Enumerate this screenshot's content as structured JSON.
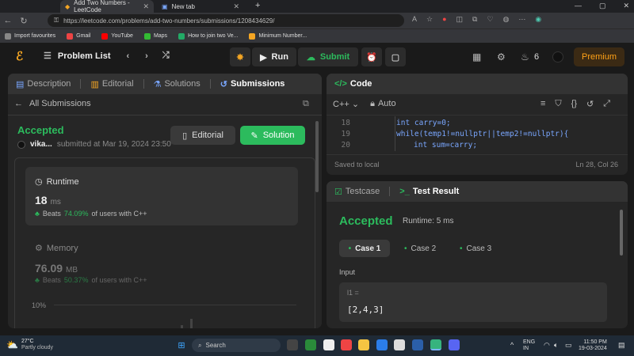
{
  "browser": {
    "tabs": [
      {
        "title": "Add Two Numbers - LeetCode",
        "active": true
      },
      {
        "title": "New tab",
        "active": false
      }
    ],
    "url": "https://leetcode.com/problems/add-two-numbers/submissions/1208434629/",
    "bookmarks": [
      "Import favourites",
      "Gmail",
      "YouTube",
      "Maps",
      "How to join two Ve...",
      "Minimum Number..."
    ]
  },
  "header": {
    "problem_list": "Problem List",
    "run": "Run",
    "submit": "Submit",
    "streak": "6",
    "premium": "Premium"
  },
  "left_panel": {
    "tabs": [
      "Description",
      "Editorial",
      "Solutions",
      "Submissions"
    ],
    "back_label": "All Submissions",
    "status": "Accepted",
    "user": "vika...",
    "submitted_at": "submitted at Mar 19, 2024 23:50",
    "editorial_btn": "Editorial",
    "solution_btn": "Solution",
    "runtime": {
      "label": "Runtime",
      "value": "18",
      "unit": "ms",
      "beats_label": "Beats",
      "beats": "74.09%",
      "suffix": "of users with C++"
    },
    "memory": {
      "label": "Memory",
      "value": "76.09",
      "unit": "MB",
      "beats_label": "Beats",
      "beats": "50.37%",
      "suffix": "of users with C++"
    },
    "chart_tick": "10%"
  },
  "code_panel": {
    "title": "Code",
    "language": "C++",
    "mode": "Auto",
    "lines": [
      {
        "n": "18",
        "code": "int carry=0;"
      },
      {
        "n": "19",
        "code": "while(temp1!=nullptr||temp2!=nullptr){"
      },
      {
        "n": "20",
        "code": "int sum=carry;"
      }
    ],
    "saved": "Saved to local",
    "cursor": "Ln 28, Col 26"
  },
  "result_panel": {
    "tabs": [
      "Testcase",
      "Test Result"
    ],
    "status": "Accepted",
    "runtime": "Runtime: 5 ms",
    "cases": [
      "Case 1",
      "Case 2",
      "Case 3"
    ],
    "input_label": "Input",
    "var_label": "l1 =",
    "var_value": "[2,4,3]"
  },
  "taskbar": {
    "temp": "27°C",
    "weather": "Partly cloudy",
    "search": "Search",
    "lang1": "ENG",
    "lang2": "IN",
    "time": "11:50 PM",
    "date": "19-03-2024"
  }
}
